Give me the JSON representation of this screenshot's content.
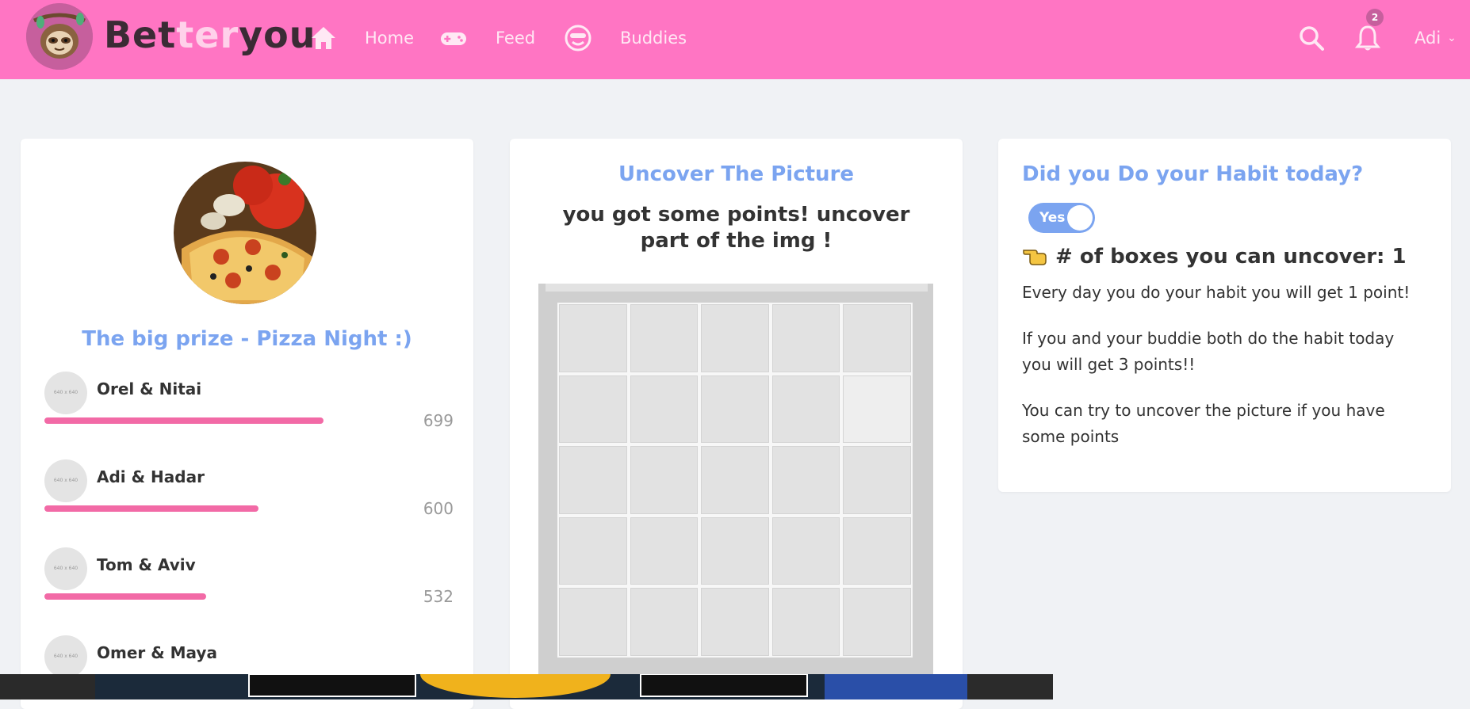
{
  "navbar": {
    "brand": {
      "part1": "Bet",
      "part2": "ter",
      "part3": "you"
    },
    "links": {
      "home": "Home",
      "feed": "Feed",
      "buddies": "Buddies"
    },
    "notification_count": "2",
    "user": "Adi",
    "colors": {
      "background": "#ff75c3",
      "brand_dark": "#3b2b35",
      "link": "#ffe8f4"
    }
  },
  "prize": {
    "title": "The big prize - Pizza Night :)",
    "leaders": [
      {
        "names": "Orel & Nitai",
        "score": "699",
        "avatar_text": "640 x 640"
      },
      {
        "names": "Adi & Hadar",
        "score": "600",
        "avatar_text": "640 x 640"
      },
      {
        "names": "Tom & Aviv",
        "score": "532",
        "avatar_text": "640 x 640"
      },
      {
        "names": "Omer & Maya",
        "score": "",
        "avatar_text": "640 x 640"
      }
    ],
    "bar_color": "#f26aa6"
  },
  "uncover": {
    "title": "Uncover The Picture",
    "subtitle": "you got some points! uncover part of the img !"
  },
  "habit": {
    "title": "Did you Do your Habit today?",
    "toggle_label": "Yes",
    "boxes_text": "# of boxes you can uncover: 1",
    "paragraphs": [
      "Every day you do your habit you will get 1 point!",
      "If you and your buddie both do the habit today you will get 3 points!!",
      "You can try to uncover the picture if you have some points"
    ],
    "accent": "#7ba4f0"
  }
}
